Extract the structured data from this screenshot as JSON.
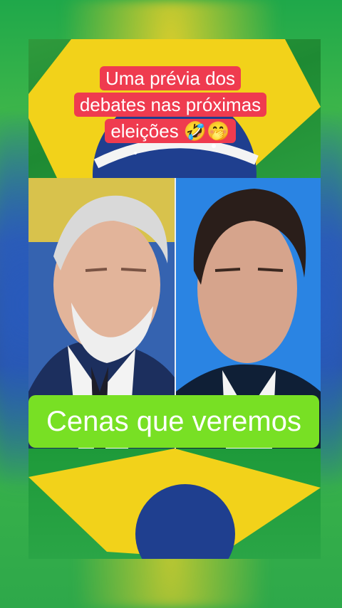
{
  "caption_top": {
    "line1": "Uma prévia dos",
    "line2": "debates nas próximas",
    "line3": "eleições 🤣🤭"
  },
  "caption_bottom": {
    "text": "Cenas que veremos"
  },
  "colors": {
    "caption_top_bg": "#ef3b4f",
    "caption_bottom_bg": "#78e024",
    "flag_green": "#1e9a3a",
    "flag_yellow": "#f2d21a",
    "flag_blue": "#1f3f8f"
  }
}
